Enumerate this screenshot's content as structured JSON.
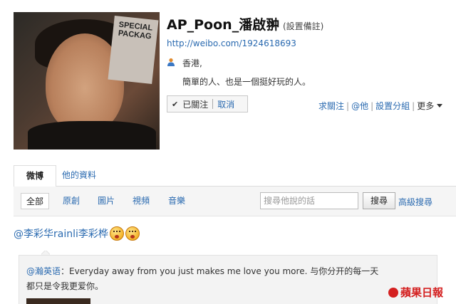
{
  "profile": {
    "name": "AP_Poon_潘啟翀",
    "remark_label": "(設置備註)",
    "url": "http://weibo.com/1924618693",
    "location": "香港,",
    "bio": "簡單的人、也是一個挺好玩的人。",
    "avatar_magazine_text": "SPECIAL PACKAG"
  },
  "follow": {
    "check": "✔",
    "followed_label": "已關注",
    "cancel_label": "取消"
  },
  "actions": {
    "ask_follow": "求關注",
    "at_him": "@他",
    "set_group": "設置分組",
    "more": "更多"
  },
  "tabs": {
    "weibo": "微博",
    "his_info": "他的資料"
  },
  "filters": {
    "all": "全部",
    "original": "原創",
    "pictures": "圖片",
    "videos": "視頻",
    "music": "音樂",
    "search_placeholder": "搜尋他說的話",
    "search_button": "搜尋",
    "advanced_search": "高級搜尋"
  },
  "post": {
    "mention": "@李彩华rainli李彩桦",
    "repost_user": "@瀚英语",
    "repost_text": "：Everyday away from you just makes me love you more. 与你分开的每一天都只是令我更爱你。"
  },
  "watermark": "蘋果日報",
  "colors": {
    "link": "#2a6ab0",
    "watermark": "#d42020"
  }
}
